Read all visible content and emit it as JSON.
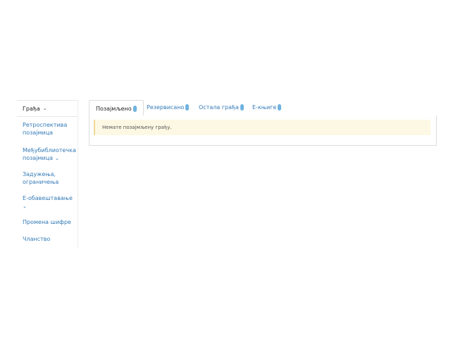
{
  "sidebar": {
    "header": "Грађа",
    "items": [
      {
        "line1": "Ретроспектива",
        "line2": "позајмица"
      },
      {
        "line1": "Међубиблиотечка",
        "line2": "позајмица"
      },
      {
        "line1": "Задужења,",
        "line2": "ограничења"
      },
      {
        "line1": "Е-обавештавање",
        "line2": ""
      },
      {
        "line1": "Промена шифре",
        "line2": ""
      },
      {
        "line1": "Чланство",
        "line2": ""
      }
    ]
  },
  "tabs": [
    {
      "label": "Позајмљено",
      "active": true
    },
    {
      "label": "Резервисано",
      "active": false
    },
    {
      "label": "Остала грађа",
      "active": false
    },
    {
      "label": "Е-књиге",
      "active": false
    }
  ],
  "alert": {
    "message": "Немате позајмљену грађу."
  },
  "colors": {
    "link": "#337ab7",
    "badge": "#6fb3e0",
    "alert_bg": "#fcf8e3",
    "alert_border": "#f0d898"
  }
}
